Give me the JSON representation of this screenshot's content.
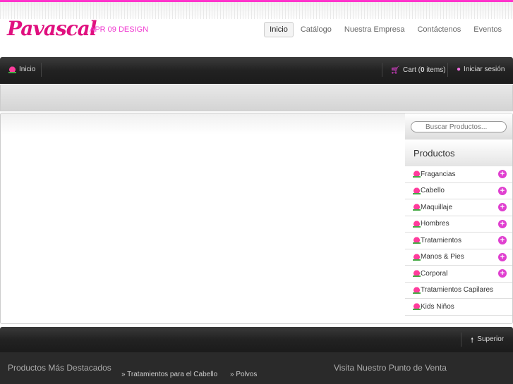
{
  "brand": {
    "logo": "Pavascal",
    "tagline": "APR 09 DESIGN",
    "accent": "#ff33cc"
  },
  "nav": [
    "Inicio",
    "Catálogo",
    "Nuestra Empresa",
    "Contáctenos",
    "Eventos"
  ],
  "bar": {
    "home": "Inicio",
    "cart_prefix": "Cart (",
    "cart_count": "0",
    "cart_suffix": " items)",
    "login": "Iniciar sesión"
  },
  "search": {
    "placeholder": "Buscar Productos..."
  },
  "products": {
    "title": "Productos",
    "items": [
      {
        "label": "Fragancias",
        "expand": true
      },
      {
        "label": "Cabello",
        "expand": true
      },
      {
        "label": "Maquillaje",
        "expand": true
      },
      {
        "label": "Hombres",
        "expand": true
      },
      {
        "label": "Tratamientos",
        "expand": true
      },
      {
        "label": "Manos & Pies",
        "expand": true
      },
      {
        "label": "Corporal",
        "expand": true
      },
      {
        "label": "Tratamientos Capilares",
        "expand": false
      },
      {
        "label": "Kids Niños",
        "expand": false
      }
    ]
  },
  "footer": {
    "top_link": "Superior",
    "featured_title": "Productos Más Destacados",
    "links": [
      "Tratamientos para el Cabello",
      "Polvos"
    ],
    "visit_title": "Visita Nuestro Punto de Venta"
  }
}
